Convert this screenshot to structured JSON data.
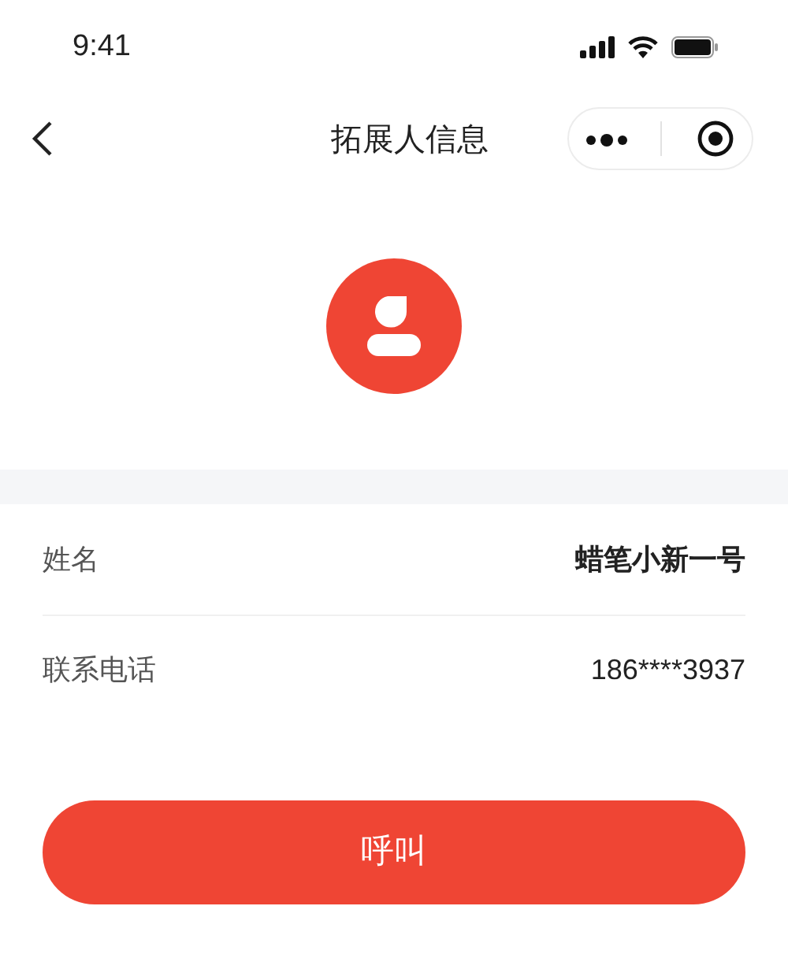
{
  "status_bar": {
    "time": "9:41"
  },
  "nav": {
    "title": "拓展人信息"
  },
  "fields": [
    {
      "label": "姓名",
      "value": "蜡笔小新一号",
      "bold": true
    },
    {
      "label": "联系电话",
      "value": "186****3937",
      "bold": false
    }
  ],
  "call_button": {
    "label": "呼叫"
  }
}
